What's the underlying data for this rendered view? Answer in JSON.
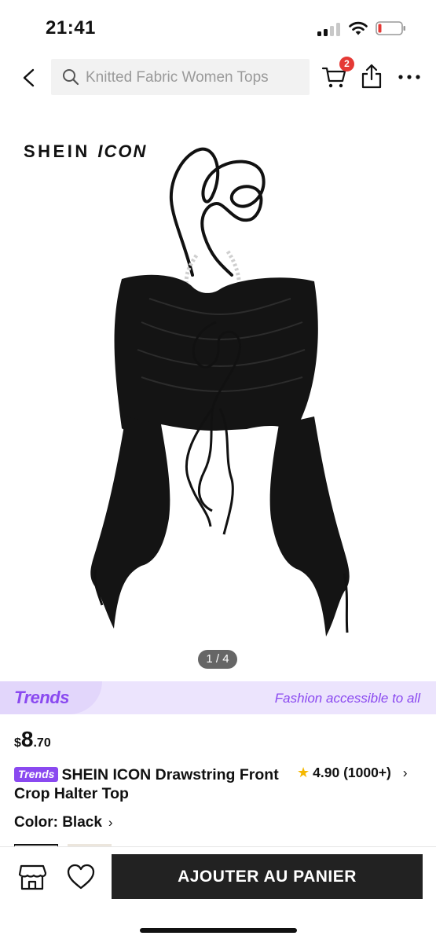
{
  "status_bar": {
    "time": "21:41"
  },
  "nav": {
    "search_placeholder": "Knitted Fabric Women Tops",
    "cart_badge_count": "2"
  },
  "gallery": {
    "brand_name": "SHEIN",
    "brand_suffix": "ICON",
    "page_indicator": "1 / 4"
  },
  "trends_banner": {
    "logo": "Trends",
    "tagline": "Fashion accessible to all"
  },
  "product": {
    "price_currency": "$",
    "price_whole": "8",
    "price_decimal": ".70",
    "tag": "Trends",
    "title": "SHEIN ICON Drawstring Front Crop Halter Top",
    "rating_value": "4.90",
    "rating_count": "(1000+)",
    "color_label": "Color: Black"
  },
  "bottom_bar": {
    "add_to_cart_label": "AJOUTER AU PANIER"
  },
  "colors": {
    "accent_purple": "#8a49f0",
    "badge_red": "#e53935",
    "star_yellow": "#f5b800",
    "button_dark": "#222222"
  }
}
